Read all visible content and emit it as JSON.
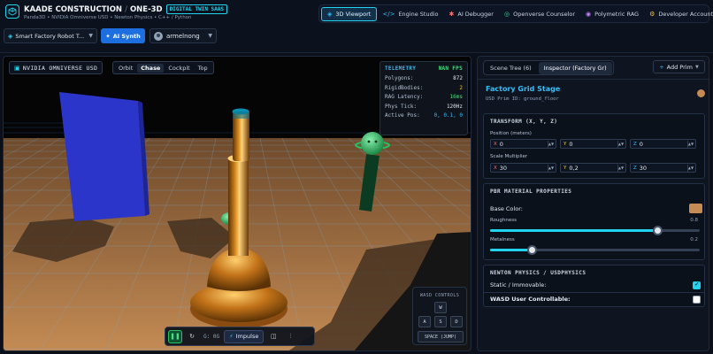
{
  "header": {
    "brand": "KAADE CONSTRUCTION",
    "separator": "/",
    "product": "ONE-3D",
    "badge": "DIGITAL TWIN SAAS",
    "subtitle": "Panda3D • NVIDIA Omniverse USD • Newton Physics • C++ / Python"
  },
  "nav": {
    "tabs": [
      {
        "label": "3D Viewport",
        "icon": "cube-icon",
        "active": true
      },
      {
        "label": "Engine Studio",
        "icon": "code-icon",
        "active": false
      },
      {
        "label": "AI Debugger",
        "icon": "bug-icon",
        "active": false
      },
      {
        "label": "Openverse Counselor",
        "icon": "compass-icon",
        "active": false
      },
      {
        "label": "Polymetric RAG",
        "icon": "database-icon",
        "active": false
      },
      {
        "label": "Developer Accounts",
        "icon": "gear-icon",
        "active": false
      }
    ]
  },
  "toolbar_top": {
    "project": "Smart Factory Robot T...",
    "ai_button": "AI Synth",
    "user": "armelnong"
  },
  "viewport": {
    "label": "NVIDIA OMNIVERSE USD",
    "camera_tabs": [
      "Orbit",
      "Chase",
      "Cockpit",
      "Top"
    ],
    "active_camera": "Chase",
    "telemetry": {
      "title": "TELEMETRY",
      "fps": "NAN FPS",
      "rows": [
        {
          "label": "Polygons:",
          "value": "872",
          "color": "#e2e8f0"
        },
        {
          "label": "RigidBodies:",
          "value": "2",
          "color": "#facc15"
        },
        {
          "label": "RAG Latency:",
          "value": "16ms",
          "color": "#4ade80"
        },
        {
          "label": "Phys Tick:",
          "value": "120Hz",
          "color": "#e2e8f0"
        },
        {
          "label": "Active Pos:",
          "value": "0, 0.1, 0",
          "color": "#38bdf8"
        }
      ]
    },
    "wasd": {
      "title": "WASD CONTROLS",
      "keys": {
        "w": "W",
        "a": "A",
        "s": "S",
        "d": "D",
        "space": "SPACE (JUMP)"
      }
    },
    "bottom_toolbar": {
      "pause_icon": "pause-icon",
      "reset_icon": "reset-icon",
      "gravity": "G: 0G",
      "impulse": "Impulse",
      "layers_icon": "layers-icon",
      "settings_icon": "sliders-icon"
    }
  },
  "panel": {
    "tabs": [
      "Scene Tree (6)",
      "Inspector (Factory Gr)"
    ],
    "active_tab": "Inspector (Factory Gr)",
    "add_prim": "Add Prim",
    "prim_title": "Factory Grid Stage",
    "prim_id": "USD Prim ID: ground_floor",
    "prim_color": "#c48b54",
    "transform": {
      "title": "TRANSFORM (X, Y, Z)",
      "position_label": "Position (meters)",
      "position": {
        "x": "0",
        "y": "0",
        "z": "0"
      },
      "scale_label": "Scale Multiplier",
      "scale": {
        "x": "30",
        "y": "0,2",
        "z": "30"
      }
    },
    "material": {
      "title": "PBR MATERIAL PROPERTIES",
      "base_color_label": "Base Color:",
      "base_color": "#c48b54",
      "roughness_label": "Roughness",
      "roughness": "0.8",
      "roughness_fraction": 0.8,
      "metalness_label": "Metalness",
      "metalness": "0.2",
      "metalness_fraction": 0.2
    },
    "physics": {
      "title": "NEWTON PHYSICS / USDPHYSICS",
      "static_label": "Static / Immovable:",
      "static": true,
      "wasd_label": "WASD User Controllable:",
      "wasd": false
    }
  },
  "colors": {
    "accent": "#22d3ee",
    "primary_button": "#1d6fe0",
    "floor": "#c48b54",
    "background": "#0a0f1a"
  }
}
